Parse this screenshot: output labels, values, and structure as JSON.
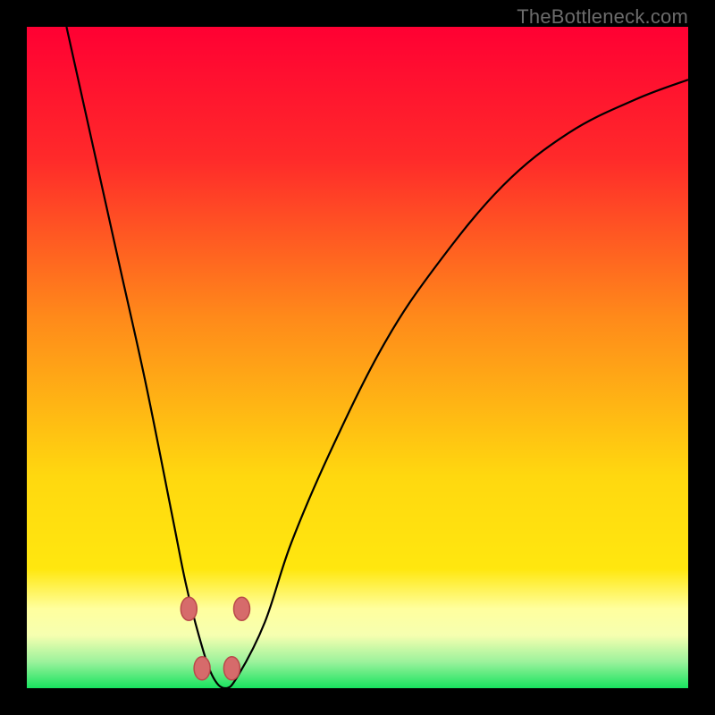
{
  "watermark": "TheBottleneck.com",
  "colors": {
    "red": "#ff0033",
    "orange": "#ff6a1a",
    "yellow": "#ffe70f",
    "paleyellow": "#ffff9e",
    "green": "#18e35f",
    "black": "#000000",
    "curve": "#000000",
    "marker_fill": "#d66b6b",
    "marker_stroke": "#b94a4a"
  },
  "chart_data": {
    "type": "line",
    "title": "",
    "xlabel": "",
    "ylabel": "",
    "xlim": [
      0,
      100
    ],
    "ylim": [
      0,
      100
    ],
    "series": [
      {
        "name": "bottleneck_curve",
        "x": [
          6,
          10,
          14,
          18,
          22,
          24,
          26,
          28,
          30,
          32,
          36,
          40,
          46,
          54,
          62,
          72,
          82,
          92,
          100
        ],
        "y": [
          100,
          82,
          64,
          46,
          26,
          16,
          8,
          2,
          0,
          2,
          10,
          22,
          36,
          52,
          64,
          76,
          84,
          89,
          92
        ]
      }
    ],
    "markers": [
      {
        "x": 24.5,
        "y": 12
      },
      {
        "x": 32.5,
        "y": 12
      },
      {
        "x": 26.5,
        "y": 3
      },
      {
        "x": 31.0,
        "y": 3
      }
    ],
    "gradient_stops": [
      {
        "pos": 0.0,
        "color": "#ff0033"
      },
      {
        "pos": 0.2,
        "color": "#ff2a2a"
      },
      {
        "pos": 0.44,
        "color": "#ff8a1a"
      },
      {
        "pos": 0.68,
        "color": "#ffd80f"
      },
      {
        "pos": 0.82,
        "color": "#ffe70f"
      },
      {
        "pos": 0.88,
        "color": "#ffff9e"
      },
      {
        "pos": 0.92,
        "color": "#f6ffb0"
      },
      {
        "pos": 0.96,
        "color": "#9cf29c"
      },
      {
        "pos": 1.0,
        "color": "#18e35f"
      }
    ]
  }
}
